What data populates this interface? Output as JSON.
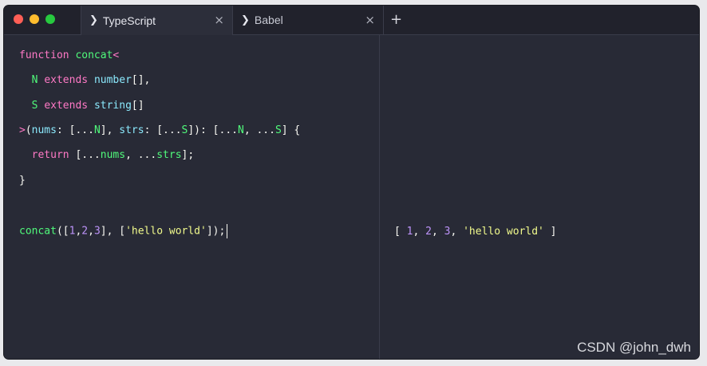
{
  "window": {
    "tabs": [
      {
        "label": "TypeScript",
        "icon": "chevron-right-icon"
      },
      {
        "label": "Babel",
        "icon": "chevron-right-icon"
      }
    ],
    "new_tab_label": "+",
    "close_glyph": "×",
    "chevron_glyph": "❯"
  },
  "editor": {
    "lines": [
      {
        "tokens": [
          {
            "t": "function",
            "k": "kw"
          },
          {
            "t": " ",
            "k": "pl"
          },
          {
            "t": "concat",
            "k": "fn"
          },
          {
            "t": "<",
            "k": "kw"
          }
        ]
      },
      {
        "tokens": [
          {
            "t": "  ",
            "k": "pl"
          },
          {
            "t": "N",
            "k": "tp"
          },
          {
            "t": " ",
            "k": "pl"
          },
          {
            "t": "extends",
            "k": "kw"
          },
          {
            "t": " ",
            "k": "pl"
          },
          {
            "t": "number",
            "k": "ty"
          },
          {
            "t": "[],",
            "k": "pl"
          }
        ]
      },
      {
        "tokens": [
          {
            "t": "  ",
            "k": "pl"
          },
          {
            "t": "S",
            "k": "tp"
          },
          {
            "t": " ",
            "k": "pl"
          },
          {
            "t": "extends",
            "k": "kw"
          },
          {
            "t": " ",
            "k": "pl"
          },
          {
            "t": "string",
            "k": "ty"
          },
          {
            "t": "[]",
            "k": "pl"
          }
        ]
      },
      {
        "tokens": [
          {
            "t": ">",
            "k": "kw"
          },
          {
            "t": "(",
            "k": "pl"
          },
          {
            "t": "nums",
            "k": "ty"
          },
          {
            "t": ": [...",
            "k": "pl"
          },
          {
            "t": "N",
            "k": "tp"
          },
          {
            "t": "], ",
            "k": "pl"
          },
          {
            "t": "strs",
            "k": "ty"
          },
          {
            "t": ": [...",
            "k": "pl"
          },
          {
            "t": "S",
            "k": "tp"
          },
          {
            "t": "]): [...",
            "k": "pl"
          },
          {
            "t": "N",
            "k": "tp"
          },
          {
            "t": ", ...",
            "k": "pl"
          },
          {
            "t": "S",
            "k": "tp"
          },
          {
            "t": "] {",
            "k": "pl"
          }
        ]
      },
      {
        "tokens": [
          {
            "t": "  ",
            "k": "pl"
          },
          {
            "t": "return",
            "k": "kw"
          },
          {
            "t": " [...",
            "k": "pl"
          },
          {
            "t": "nums",
            "k": "fn"
          },
          {
            "t": ", ...",
            "k": "pl"
          },
          {
            "t": "strs",
            "k": "fn"
          },
          {
            "t": "];",
            "k": "pl"
          }
        ]
      },
      {
        "tokens": [
          {
            "t": "}",
            "k": "pl"
          }
        ]
      },
      {
        "tokens": []
      },
      {
        "tokens": [
          {
            "t": "concat",
            "k": "fn"
          },
          {
            "t": "([",
            "k": "pl"
          },
          {
            "t": "1",
            "k": "nu"
          },
          {
            "t": ",",
            "k": "pl"
          },
          {
            "t": "2",
            "k": "nu"
          },
          {
            "t": ",",
            "k": "pl"
          },
          {
            "t": "3",
            "k": "nu"
          },
          {
            "t": "], [",
            "k": "pl"
          },
          {
            "t": "'hello world'",
            "k": "st"
          },
          {
            "t": "]);",
            "k": "pl"
          }
        ],
        "cursor": true
      }
    ]
  },
  "output": {
    "tokens": [
      {
        "t": "[ ",
        "k": "pl"
      },
      {
        "t": "1",
        "k": "nu"
      },
      {
        "t": ", ",
        "k": "pl"
      },
      {
        "t": "2",
        "k": "nu"
      },
      {
        "t": ", ",
        "k": "pl"
      },
      {
        "t": "3",
        "k": "nu"
      },
      {
        "t": ", ",
        "k": "pl"
      },
      {
        "t": "'hello world'",
        "k": "st"
      },
      {
        "t": " ]",
        "k": "pl"
      }
    ]
  },
  "watermark": "CSDN @john_dwh",
  "colors": {
    "background": "#282a36",
    "keyword": "#ff79c6",
    "function": "#50fa7b",
    "type": "#8be9fd",
    "string": "#f1fa8c",
    "number": "#bd93f9"
  }
}
